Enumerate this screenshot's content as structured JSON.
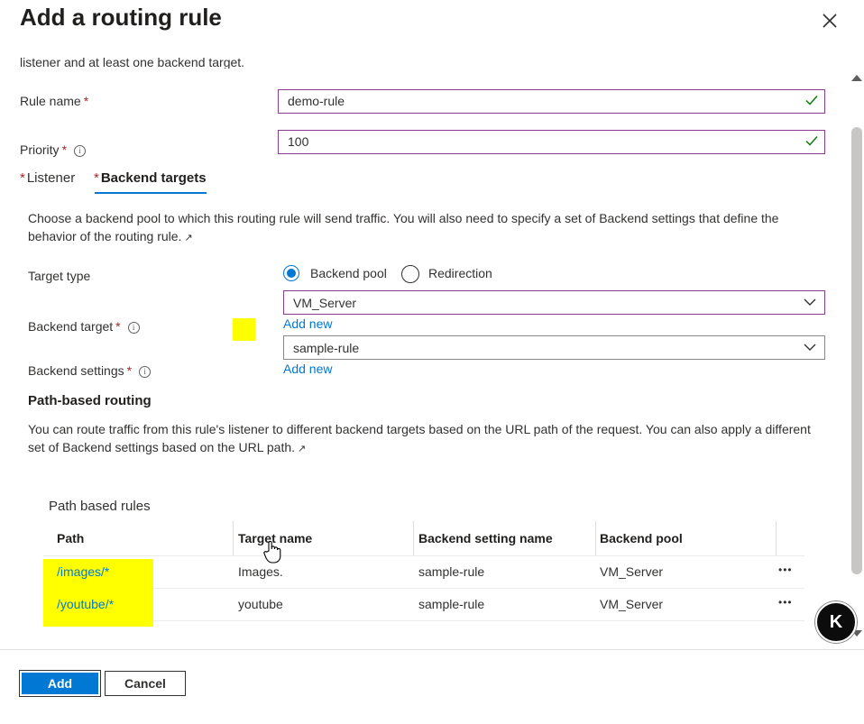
{
  "dialog": {
    "title": "Add a routing rule",
    "clipped_text": "listener and at least one backend target."
  },
  "form": {
    "rule_name": {
      "label": "Rule name",
      "required": "*",
      "value": "demo-rule"
    },
    "priority": {
      "label": "Priority",
      "required": "*",
      "value": "100",
      "info": "i"
    }
  },
  "tabs": [
    {
      "label": "Listener",
      "required": "*",
      "active": false
    },
    {
      "label": "Backend targets",
      "required": "*",
      "active": true
    }
  ],
  "backend": {
    "description": "Choose a backend pool to which this routing rule will send traffic. You will also need to specify a set of Backend settings that define the behavior of the routing rule.",
    "target_type": {
      "label": "Target type",
      "options": [
        {
          "label": "Backend pool",
          "selected": true
        },
        {
          "label": "Redirection",
          "selected": false
        }
      ]
    },
    "backend_target": {
      "label": "Backend target",
      "required": "*",
      "info": "i",
      "value": "VM_Server",
      "add_new": "Add new"
    },
    "backend_settings": {
      "label": "Backend settings",
      "required": "*",
      "info": "i",
      "value": "sample-rule",
      "add_new": "Add new"
    }
  },
  "path_routing": {
    "heading": "Path-based routing",
    "description": "You can route traffic from this rule's listener to different backend targets based on the URL path of the request. You can also apply a different set of Backend settings based on the URL path.",
    "table_title": "Path based rules",
    "columns": [
      "Path",
      "Target name",
      "Backend setting name",
      "Backend pool"
    ],
    "rows": [
      {
        "path": "/images/*",
        "target": "Images.",
        "setting": "sample-rule",
        "pool": "VM_Server",
        "more": "•••"
      },
      {
        "path": "/youtube/*",
        "target": "youtube",
        "setting": "sample-rule",
        "pool": "VM_Server",
        "more": "•••"
      }
    ]
  },
  "footer": {
    "add": "Add",
    "cancel": "Cancel"
  },
  "badge": {
    "label": "K"
  },
  "colors": {
    "accent": "#0078d4",
    "highlight": "#ffff00",
    "required": "#a4262c",
    "valid": "#107c10"
  },
  "icons": [
    "close-icon",
    "checkmark-icon",
    "info-icon",
    "external-link-icon",
    "chevron-down-icon",
    "more-icon",
    "hand-cursor-icon"
  ]
}
